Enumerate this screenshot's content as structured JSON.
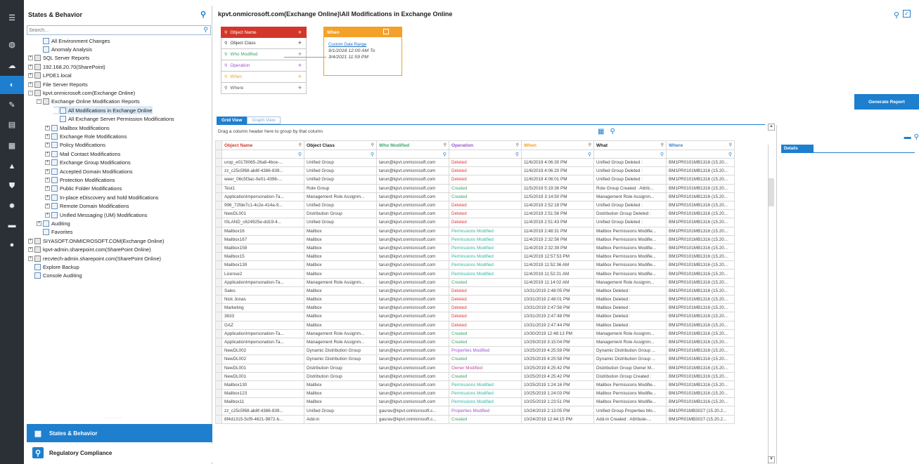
{
  "rail": {
    "items": [
      {
        "icon": "menu-icon",
        "glyph": "☰"
      },
      {
        "icon": "dashboard-icon",
        "glyph": "◍"
      },
      {
        "icon": "cloud-icon",
        "glyph": "☁"
      },
      {
        "icon": "states-icon",
        "glyph": "◐",
        "active": true
      },
      {
        "icon": "key-icon",
        "glyph": "✎"
      },
      {
        "icon": "database-icon",
        "glyph": "▤"
      },
      {
        "icon": "report-icon",
        "glyph": "▦"
      },
      {
        "icon": "bell-icon",
        "glyph": "▲"
      },
      {
        "icon": "shield-icon",
        "glyph": "⛊"
      },
      {
        "icon": "settings-icon",
        "glyph": "✹"
      },
      {
        "icon": "chat-icon",
        "glyph": "▬"
      },
      {
        "icon": "user-icon",
        "glyph": "●"
      }
    ]
  },
  "states": {
    "title": "States & Behavior",
    "search_placeholder": "Search..."
  },
  "tree": [
    {
      "label": "All Environment Changes",
      "indent": 1,
      "exp": "",
      "icon": "doc"
    },
    {
      "label": "Anomaly Analysis",
      "indent": 1,
      "exp": "",
      "icon": "doc"
    },
    {
      "label": "SQL Server Reports",
      "indent": 0,
      "exp": "+",
      "icon": "server"
    },
    {
      "label": "192.168.20.70(SharePoint)",
      "indent": 0,
      "exp": "+",
      "icon": "server"
    },
    {
      "label": "LPDE1.local",
      "indent": 0,
      "exp": "+",
      "icon": "server"
    },
    {
      "label": "File Server Reports",
      "indent": 0,
      "exp": "+",
      "icon": "server"
    },
    {
      "label": "kpvt.onmicrosoft.com(Exchange Online)",
      "indent": 0,
      "exp": "−",
      "icon": "server"
    },
    {
      "label": "Exchange Online Modification Reports",
      "indent": 1,
      "exp": "−",
      "icon": "server"
    },
    {
      "label": "All Modifications in Exchange Online",
      "indent": 3,
      "exp": "",
      "icon": "doc",
      "sel": true
    },
    {
      "label": "All Exchange Server Permission Modifications",
      "indent": 3,
      "exp": "",
      "icon": "doc"
    },
    {
      "label": "Mailbox Modifications",
      "indent": 2,
      "exp": "+",
      "icon": "doc"
    },
    {
      "label": "Exchange Role Modifications",
      "indent": 2,
      "exp": "+",
      "icon": "doc"
    },
    {
      "label": "Policy Modifications",
      "indent": 2,
      "exp": "+",
      "icon": "doc"
    },
    {
      "label": "Mail Contact Modifications",
      "indent": 2,
      "exp": "+",
      "icon": "doc"
    },
    {
      "label": "Exchange Group Modifications",
      "indent": 2,
      "exp": "+",
      "icon": "doc"
    },
    {
      "label": "Accepted Domain Modifications",
      "indent": 2,
      "exp": "+",
      "icon": "doc"
    },
    {
      "label": "Protection Modifications",
      "indent": 2,
      "exp": "+",
      "icon": "doc"
    },
    {
      "label": "Public Folder Modifications",
      "indent": 2,
      "exp": "+",
      "icon": "doc"
    },
    {
      "label": "In-place eDiscovery and hold Modifications",
      "indent": 2,
      "exp": "+",
      "icon": "doc"
    },
    {
      "label": "Remote Domain Modifications",
      "indent": 2,
      "exp": "+",
      "icon": "doc"
    },
    {
      "label": "Unified Messaging (UM) Modifications",
      "indent": 2,
      "exp": "+",
      "icon": "doc"
    },
    {
      "label": "Auditing",
      "indent": 1,
      "exp": "+",
      "icon": "doc"
    },
    {
      "label": "Favorites",
      "indent": 1,
      "exp": "",
      "icon": "doc"
    },
    {
      "label": "SIYASOFT.ONMICROSOFT.COM(Exchange Online)",
      "indent": 0,
      "exp": "+",
      "icon": "server"
    },
    {
      "label": "kpvt-admin.sharepoint.com(SharePoint Online)",
      "indent": 0,
      "exp": "+",
      "icon": "server"
    },
    {
      "label": "recvtech-admin.sharepoint.com(SharePoint Online)",
      "indent": 0,
      "exp": "+",
      "icon": "server"
    },
    {
      "label": "Explore Backup",
      "indent": 0,
      "exp": "",
      "icon": "doc"
    },
    {
      "label": "Console Auditing",
      "indent": 0,
      "exp": "",
      "icon": "doc"
    }
  ],
  "bottom_nav": {
    "dots": "..........",
    "states_label": "States & Behavior",
    "regulatory_label": "Regulatory Compliance"
  },
  "main": {
    "title": "kpvt.onmicrosoft.com(Exchange Online)\\All Modifications in Exchange Online",
    "criteria": [
      "Object Name",
      "Object Class",
      "Who Modified",
      "Operation",
      "When",
      "Where"
    ],
    "when_card": {
      "title": "When",
      "range_type": "Custom Date Range",
      "from": "9/1/2018 12:00 AM To",
      "to": "3/4/2021 11:59 PM"
    },
    "generate_label": "Generate Report"
  },
  "grid": {
    "tabs": [
      "Grid View",
      "Graph View"
    ],
    "group_hint": "Drag a column header here to group by that column.",
    "columns": [
      "Object Name",
      "Object Class",
      "Who Modified",
      "Operation",
      "When",
      "What",
      "Where"
    ],
    "rows": [
      [
        "urop_e0178065-26a8-4bce-...",
        "Unified Group",
        "tarun@kpvt.onmicrosoft.com",
        "Deleted",
        "11/6/2019 4:06:30 PM",
        "Unified Group Deleted :",
        "BM1PR0101MB1316 (15.20..."
      ],
      [
        "zz_c25c5f68-ab8f-4386-839...",
        "Unified Group",
        "tarun@kpvt.onmicrosoft.com",
        "Deleted",
        "11/6/2019 4:06:20 PM",
        "Unified Group Deleted :",
        "BM1PR0101MB1316 (15.20..."
      ],
      [
        "weer_06c5f3ac-0e01-4396-...",
        "Unified Group",
        "tarun@kpvt.onmicrosoft.com",
        "Deleted",
        "11/6/2019 4:06:01 PM",
        "Unified Group Deleted :",
        "BM1PR0101MB1316 (15.20..."
      ],
      [
        "Test1",
        "Role Group",
        "tarun@kpvt.onmicrosoft.com",
        "Created",
        "11/5/2019 5:19:36 PM",
        "Role Group Created : Attrib...",
        "BM1PR0101MB1316 (15.20..."
      ],
      [
        "ApplicationImpersonation-Ta...",
        "Management Role Assignm...",
        "tarun@kpvt.onmicrosoft.com",
        "Created",
        "11/5/2019 3:14:50 PM",
        "Management Role Assignm...",
        "BM1PR0101MB1316 (15.20..."
      ],
      [
        "996_72fde7c1-4c2e-414a-9...",
        "Unified Group",
        "tarun@kpvt.onmicrosoft.com",
        "Deleted",
        "11/4/2019 2:52:18 PM",
        "Unified Group Deleted :",
        "BM1PR0101MB1316 (15.20..."
      ],
      [
        "NewDL001",
        "Distribution Group",
        "tarun@kpvt.onmicrosoft.com",
        "Deleted",
        "11/4/2019 2:51:56 PM",
        "Distribution Group Deleted :",
        "BM1PR0101MB1316 (15.20..."
      ],
      [
        "ISLAND_c624925e-dd19-4...",
        "Unified Group",
        "tarun@kpvt.onmicrosoft.com",
        "Deleted",
        "11/4/2019 2:51:43 PM",
        "Unified Group Deleted :",
        "BM1PR0101MB1316 (15.20..."
      ],
      [
        "Mailbox16",
        "Mailbox",
        "tarun@kpvt.onmicrosoft.com",
        "Permissions Modified",
        "11/4/2019 2:48:31 PM",
        "Mailbox Permissions Modifie...",
        "BM1PR0101MB1316 (15.20..."
      ],
      [
        "Mailbox167",
        "Mailbox",
        "tarun@kpvt.onmicrosoft.com",
        "Permissions Modified",
        "11/4/2019 2:32:56 PM",
        "Mailbox Permissions Modifie...",
        "BM1PR0101MB1316 (15.20..."
      ],
      [
        "Mailbox158",
        "Mailbox",
        "tarun@kpvt.onmicrosoft.com",
        "Permissions Modified",
        "11/4/2019 2:32:39 PM",
        "Mailbox Permissions Modifie...",
        "BM1PR0101MB1316 (15.20..."
      ],
      [
        "Mailbox15",
        "Mailbox",
        "tarun@kpvt.onmicrosoft.com",
        "Permissions Modified",
        "11/4/2019 12:57:53 PM",
        "Mailbox Permissions Modifie...",
        "BM1PR0101MB1316 (15.20..."
      ],
      [
        "Mailbox139",
        "Mailbox",
        "tarun@kpvt.onmicrosoft.com",
        "Permissions Modified",
        "11/4/2019 11:52:36 AM",
        "Mailbox Permissions Modifie...",
        "BM1PR0101MB1316 (15.20..."
      ],
      [
        "License2",
        "Mailbox",
        "tarun@kpvt.onmicrosoft.com",
        "Permissions Modified",
        "11/4/2019 11:52:21 AM",
        "Mailbox Permissions Modifie...",
        "BM1PR0101MB1316 (15.20..."
      ],
      [
        "ApplicationImpersonation-Ta...",
        "Management Role Assignm...",
        "tarun@kpvt.onmicrosoft.com",
        "Created",
        "11/4/2019 11:14:02 AM",
        "Management Role Assignm...",
        "BM1PR0101MB1316 (15.20..."
      ],
      [
        "Sales",
        "Mailbox",
        "tarun@kpvt.onmicrosoft.com",
        "Deleted",
        "10/31/2019 2:48:05 PM",
        "Mailbox Deleted :",
        "BM1PR0101MB1316 (15.20..."
      ],
      [
        "Nick Jonas",
        "Mailbox",
        "tarun@kpvt.onmicrosoft.com",
        "Deleted",
        "10/31/2019 2:48:01 PM",
        "Mailbox Deleted :",
        "BM1PR0101MB1316 (15.20..."
      ],
      [
        "Marketing",
        "Mailbox",
        "tarun@kpvt.onmicrosoft.com",
        "Deleted",
        "10/31/2019 2:47:56 PM",
        "Mailbox Deleted :",
        "BM1PR0101MB1316 (15.20..."
      ],
      [
        "3633",
        "Mailbox",
        "tarun@kpvt.onmicrosoft.com",
        "Deleted",
        "10/31/2019 2:47:48 PM",
        "Mailbox Deleted :",
        "BM1PR0101MB1316 (15.20..."
      ],
      [
        "GAZ",
        "Mailbox",
        "tarun@kpvt.onmicrosoft.com",
        "Deleted",
        "10/31/2019 2:47:44 PM",
        "Mailbox Deleted :",
        "BM1PR0101MB1316 (15.20..."
      ],
      [
        "ApplicationImpersonation-Ta...",
        "Management Role Assignm...",
        "tarun@kpvt.onmicrosoft.com",
        "Created",
        "10/30/2019 12:48:13 PM",
        "Management Role Assignm...",
        "BM1PR0101MB1316 (15.20..."
      ],
      [
        "ApplicationImpersonation-Ta...",
        "Management Role Assignm...",
        "tarun@kpvt.onmicrosoft.com",
        "Created",
        "10/29/2019 3:15:04 PM",
        "Management Role Assignm...",
        "BM1PR0101MB1316 (15.20..."
      ],
      [
        "NewDL002",
        "Dynamic Distribution Group",
        "tarun@kpvt.onmicrosoft.com",
        "Properties Modified",
        "10/25/2019 4:25:59 PM",
        "Dynamic Distribution Group ...",
        "BM1PR0101MB1316 (15.20..."
      ],
      [
        "NewDL002",
        "Dynamic Distribution Group",
        "tarun@kpvt.onmicrosoft.com",
        "Created",
        "10/25/2019 4:25:58 PM",
        "Dynamic Distribution Group ...",
        "BM1PR0101MB1316 (15.20..."
      ],
      [
        "NewDL001",
        "Distribution Group",
        "tarun@kpvt.onmicrosoft.com",
        "Owner Modified",
        "10/25/2019 4:25:42 PM",
        "Distribution Group Owner M...",
        "BM1PR0101MB1316 (15.20..."
      ],
      [
        "NewDL001",
        "Distribution Group",
        "tarun@kpvt.onmicrosoft.com",
        "Created",
        "10/25/2019 4:25:42 PM",
        "Distribution Group Created :",
        "BM1PR0101MB1316 (15.20..."
      ],
      [
        "Mailbox130",
        "Mailbox",
        "tarun@kpvt.onmicrosoft.com",
        "Permissions Modified",
        "10/25/2019 1:24:16 PM",
        "Mailbox Permissions Modifie...",
        "BM1PR0101MB1316 (15.20..."
      ],
      [
        "Mailbox123",
        "Mailbox",
        "tarun@kpvt.onmicrosoft.com",
        "Permissions Modified",
        "10/25/2019 1:24:03 PM",
        "Mailbox Permissions Modifie...",
        "BM1PR0101MB1316 (15.20..."
      ],
      [
        "Mailbox11",
        "Mailbox",
        "tarun@kpvt.onmicrosoft.com",
        "Permissions Modified",
        "10/25/2019 1:23:51 PM",
        "Mailbox Permissions Modifie...",
        "BM1PR0101MB1316 (15.20..."
      ],
      [
        "zz_c25c5f68-ab8f-4386-839...",
        "Unified Group",
        "gaurav@kpvt.onmicrosoft.c...",
        "Properties Modified",
        "10/24/2019 2:13:05 PM",
        "Unified Group Properties Mo...",
        "BM1PR01MB3027 (15.20.2..."
      ],
      [
        "8f4d1315-5cf9-4621-9872-b...",
        "Add-in",
        "gaurav@kpvt.onmicrosoft.c...",
        "Created",
        "10/24/2019 12:44:15 PM",
        "Add-in Created : Attribute-...",
        "BM1PR01MB3027 (15.20.2..."
      ]
    ]
  },
  "details": {
    "tab_label": "Details"
  },
  "colors": {
    "accent": "#1e7fcf",
    "rail": "#2b2f36",
    "object_name": "#d3362a",
    "when": "#f4a12a"
  }
}
